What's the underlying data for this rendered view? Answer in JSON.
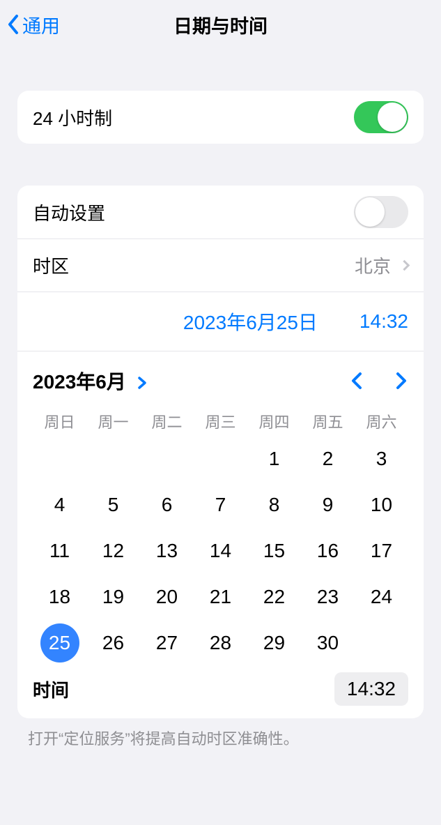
{
  "nav": {
    "back_label": "通用",
    "title": "日期与时间"
  },
  "settings": {
    "h24_label": "24 小时制",
    "h24_on": true,
    "auto_label": "自动设置",
    "auto_on": false,
    "timezone_label": "时区",
    "timezone_value": "北京",
    "date_display": "2023年6月25日",
    "time_display": "14:32"
  },
  "calendar": {
    "month_label": "2023年6月",
    "weekdays": [
      "周日",
      "周一",
      "周二",
      "周三",
      "周四",
      "周五",
      "周六"
    ],
    "leading_blanks": 4,
    "days_in_month": 30,
    "selected_day": 25
  },
  "time_section": {
    "label": "时间",
    "value": "14:32"
  },
  "footer_text": "打开“定位服务”将提高自动时区准确性。"
}
